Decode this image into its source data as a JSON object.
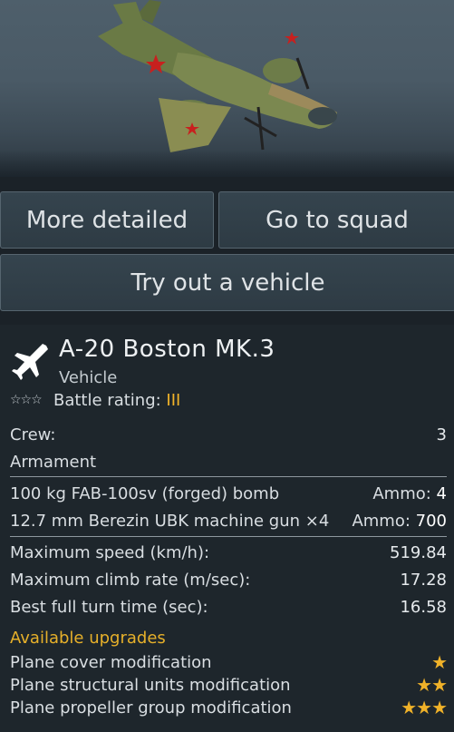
{
  "actions": {
    "more_detailed": "More detailed",
    "go_to_squad": "Go to squad",
    "try_out": "Try out a vehicle"
  },
  "vehicle": {
    "name": "A-20 Boston MK.3",
    "type": "Vehicle",
    "battle_rating_label": "Battle rating:",
    "battle_rating_value": "III",
    "rank_stars": "☆☆☆"
  },
  "stats": {
    "crew_label": "Crew:",
    "crew_value": "3",
    "armament_label": "Armament",
    "weapons": [
      {
        "name": "100 kg FAB-100sv (forged) bomb",
        "ammo_label": "Ammo:",
        "ammo_value": "4"
      },
      {
        "name": "12.7 mm Berezin UBK machine gun ×4",
        "ammo_label": "Ammo:",
        "ammo_value": "700"
      }
    ],
    "performance": [
      {
        "label": "Maximum speed (km/h):",
        "value": "519.84"
      },
      {
        "label": "Maximum climb rate (m/sec):",
        "value": "17.28"
      },
      {
        "label": "Best full turn time (sec):",
        "value": "16.58"
      }
    ]
  },
  "upgrades": {
    "title": "Available upgrades",
    "items": [
      {
        "label": "Plane cover modification",
        "stars": "★"
      },
      {
        "label": "Plane structural units modification",
        "stars": "★★"
      },
      {
        "label": "Plane propeller group modification",
        "stars": "★★★"
      }
    ]
  },
  "colors": {
    "accent_gold": "#f0b229",
    "button_bg": "#35444e",
    "panel_bg": "#1e262c"
  },
  "icons": {
    "vehicle_class": "bomber-plane-icon"
  }
}
